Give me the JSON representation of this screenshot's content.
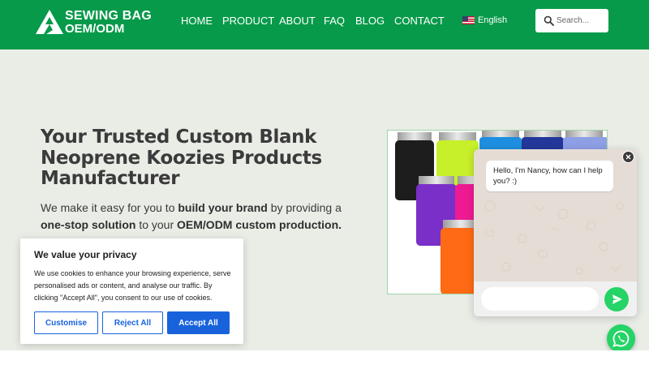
{
  "header": {
    "logo": {
      "line1": "SEWING BAG",
      "line2": "OEM/ODM"
    },
    "nav": [
      {
        "label": "HOME"
      },
      {
        "label": "PRODUCT"
      },
      {
        "label": "ABOUT"
      },
      {
        "label": "FAQ"
      },
      {
        "label": "BLOG"
      },
      {
        "label": "CONTACT"
      }
    ],
    "language": "English",
    "search": {
      "placeholder": "Search...",
      "value": ""
    }
  },
  "hero": {
    "title": "Your Trusted Custom Blank Neoprene Koozies Products Manufacturer",
    "subtitle": {
      "p1": "We make it easy for you to ",
      "b1": "build your brand",
      "p2": " by providing a ",
      "b2": "one-stop solution",
      "p3": " to your ",
      "b3": "OEM/ODM custom production."
    }
  },
  "cookie": {
    "title": "We value your privacy",
    "text": "We use cookies to enhance your browsing experience, serve personalised ads or content, and analyse our traffic. By clicking \"Accept All\", you consent to our use of cookies.",
    "customise_label": "Customise",
    "reject_label": "Reject All",
    "accept_label": "Accept All"
  },
  "chat": {
    "message": "Hello, I'm Nancy, how can I help you? :)",
    "input_value": ""
  },
  "colors": {
    "brand_green": "#079a4a",
    "cookie_blue": "#1863dc",
    "whatsapp_green": "#25d366"
  }
}
